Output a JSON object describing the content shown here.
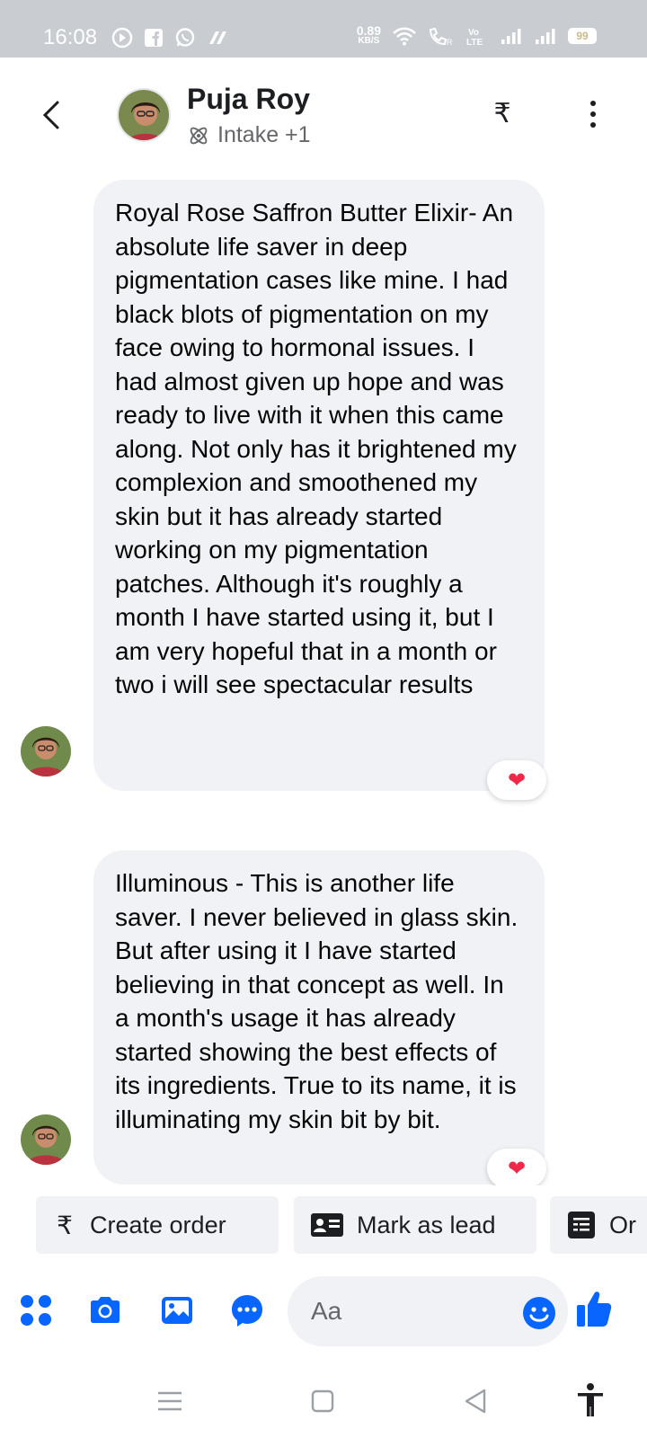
{
  "status_bar": {
    "time": "16:08",
    "net_speed_value": "0.89",
    "net_speed_unit": "KB/S",
    "battery": "99"
  },
  "header": {
    "contact_name": "Puja Roy",
    "subtitle": "Intake +1",
    "currency_symbol": "₹"
  },
  "messages": [
    {
      "text": "Royal Rose Saffron Butter Elixir- An absolute life saver in deep pigmentation cases like mine. I had black blots of pigmentation on my face owing to hormonal issues. I had almost given up hope and was ready to live with it when this came along. Not only has it brightened my complexion and smoothened my skin but it has already started working on my pigmentation patches. Although it's roughly a month I have started using it, but I am very hopeful that in a month or two i will see spectacular results",
      "reaction": "❤"
    },
    {
      "text": "Illuminous - This is another life saver. I never believed in glass skin. But after using it I have started believing in that concept as well. In a month's usage it has already started showing the best effects of its ingredients. True to its name, it is illuminating my skin bit by bit.",
      "reaction": "❤"
    }
  ],
  "quick_actions": [
    {
      "label": "Create order",
      "icon": "rupee-icon"
    },
    {
      "label": "Mark as lead",
      "icon": "contact-card-icon"
    },
    {
      "label": "Or",
      "icon": "order-list-icon"
    }
  ],
  "composer": {
    "placeholder": "Aa",
    "icons": [
      "apps-grid-icon",
      "camera-icon",
      "gallery-icon",
      "chat-more-icon",
      "emoji-icon",
      "thumbs-up-icon"
    ]
  },
  "colors": {
    "accent": "#0866ff",
    "bubble": "#f0f2f5",
    "heart": "#f02849"
  }
}
